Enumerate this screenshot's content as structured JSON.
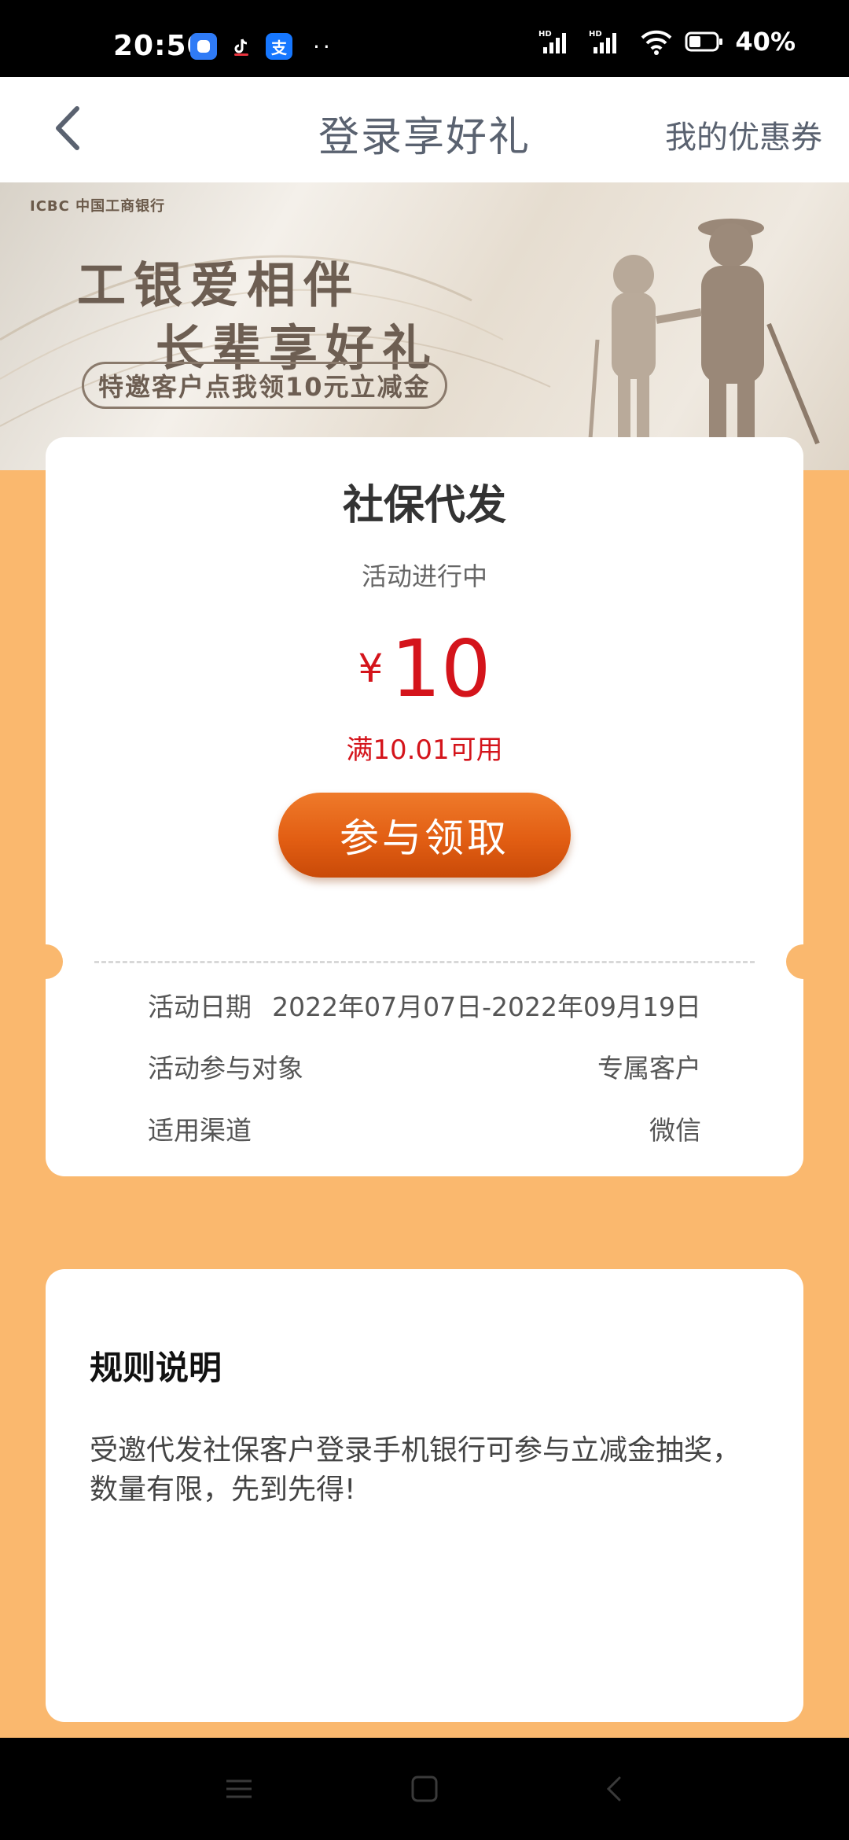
{
  "status_bar": {
    "time": "20:50",
    "app_icons": [
      "notification-app-icon",
      "tiktok-icon",
      "alipay-icon"
    ],
    "more": "··",
    "network": "HD",
    "battery": "40%"
  },
  "nav": {
    "title": "登录享好礼",
    "coupon_link": "我的优惠券"
  },
  "banner": {
    "brand": "ICBC 中国工商银行",
    "line1": "工银爱相伴",
    "line2": "长辈享好礼",
    "pill": "特邀客户点我领10元立减金"
  },
  "offer": {
    "title": "社保代发",
    "status": "活动进行中",
    "currency": "¥",
    "amount": "10",
    "condition": "满10.01可用",
    "claim_button": "参与领取",
    "details": [
      {
        "label": "活动日期",
        "value": "2022年07月07日-2022年09月19日"
      },
      {
        "label": "活动参与对象",
        "value": "专属客户"
      },
      {
        "label": "适用渠道",
        "value": "微信"
      }
    ]
  },
  "rules": {
    "title": "规则说明",
    "text": "受邀代发社保客户登录手机银行可参与立减金抽奖，数量有限，先到先得!"
  },
  "colors": {
    "page_bg": "#FAB86E",
    "accent_red": "#D4141B",
    "button_orange": "#E25E13"
  }
}
